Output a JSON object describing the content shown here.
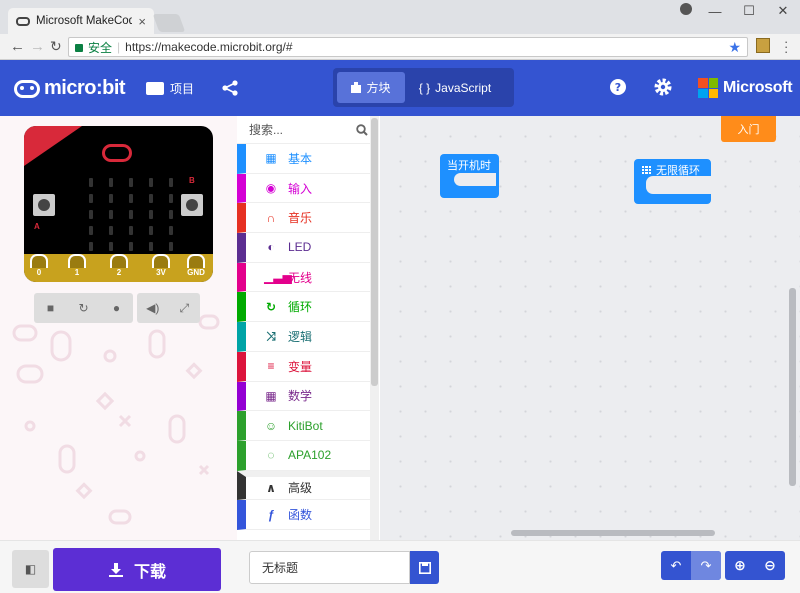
{
  "browser": {
    "tab_title": "Microsoft MakeCode fo",
    "secure_label": "安全",
    "url": "https://makecode.microbit.org/#",
    "window_buttons": [
      "—",
      "☐",
      "✕"
    ]
  },
  "header": {
    "logo_text": "micro:bit",
    "projects_label": "项目",
    "blocks_label": "方块",
    "javascript_label": "JavaScript",
    "brand": "Microsoft"
  },
  "simulator": {
    "pins": [
      "0",
      "1",
      "2",
      "3V",
      "GND"
    ],
    "labels": {
      "a": "A",
      "b": "B"
    }
  },
  "toolbox": {
    "search_placeholder": "搜索...",
    "categories": [
      {
        "label": "基本",
        "color": "#1e90ff",
        "icon": "grid-icon"
      },
      {
        "label": "输入",
        "color": "#d400d4",
        "icon": "target-icon"
      },
      {
        "label": "音乐",
        "color": "#e63022",
        "icon": "headphones-icon"
      },
      {
        "label": "LED",
        "color": "#5c2d91",
        "icon": "toggle-icon"
      },
      {
        "label": "无线",
        "color": "#e3008c",
        "icon": "signal-icon"
      },
      {
        "label": "循环",
        "color": "#00aa00",
        "icon": "refresh-icon"
      },
      {
        "label": "逻辑",
        "color": "#00a4a6",
        "icon": "shuffle-icon"
      },
      {
        "label": "变量",
        "color": "#dc143c",
        "icon": "lines-icon"
      },
      {
        "label": "数学",
        "color": "#9400d3",
        "icon": "calculator-icon"
      },
      {
        "label": "KitiBot",
        "color": "#2ca02c",
        "icon": "robot-icon"
      },
      {
        "label": "APA102",
        "color": "#2ca02c",
        "icon": "ring-icon"
      }
    ],
    "advanced": [
      {
        "label": "高级",
        "color": "#333333",
        "icon": "chevron-up-icon"
      },
      {
        "label": "函数",
        "color": "#3455db",
        "icon": "function-icon"
      }
    ]
  },
  "workspace": {
    "intro_button": "入门",
    "blocks": [
      {
        "label": "当开机时"
      },
      {
        "label": "无限循环"
      }
    ]
  },
  "bottom": {
    "download_label": "下载",
    "project_name": "无标题"
  },
  "colors": {
    "header_blue": "#3454d1",
    "download_purple": "#5c2ed4",
    "block_blue": "#1e90ff",
    "intro_orange": "#ff8c1a"
  }
}
